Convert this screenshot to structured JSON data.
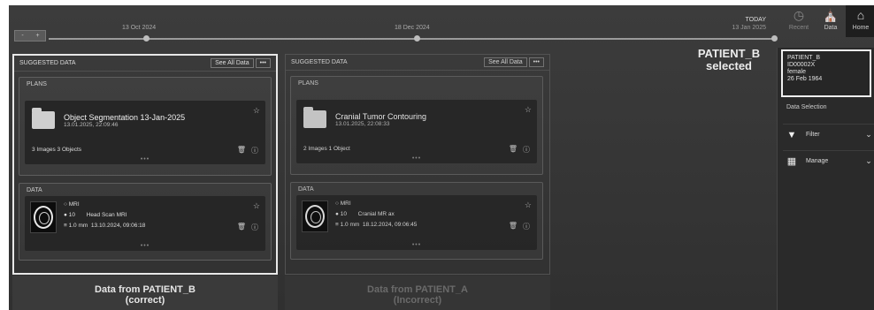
{
  "timeline": {
    "zoom_out": "-",
    "zoom_in": "+",
    "dates": [
      "13 Oct 2024",
      "18 Dec 2024"
    ],
    "today_label": "TODAY",
    "today_date": "13 Jan 2025"
  },
  "topbar": {
    "recent_label": "Recent",
    "data_label": "Data",
    "home_label": "Home"
  },
  "selection": {
    "label": "PATIENT_B\nselected"
  },
  "patient": {
    "name": "PATIENT_B",
    "id": "ID00002X",
    "sex": "female",
    "dob": "26 Feb 1964"
  },
  "sidebar": {
    "section_label": "Data Selection",
    "filter_label": "Filter",
    "manage_label": "Manage"
  },
  "columns": [
    {
      "header": "SUGGESTED DATA",
      "see_all": "See All Data",
      "more": "•••",
      "plans_title": "PLANS",
      "plan_name": "Object Segmentation 13-Jan-2025",
      "plan_date": "13.01.2025, 22:09:46",
      "plan_counts": "3 Images  3 Objects",
      "data_title": "DATA",
      "modality": "MRI",
      "num": "10",
      "series_name": "Head Scan MRI",
      "slice": "1.0 mm",
      "series_date": "13.10.2024, 09:06:18",
      "footer": "Data from PATIENT_B\n(correct)"
    },
    {
      "header": "SUGGESTED DATA",
      "see_all": "See All Data",
      "more": "•••",
      "plans_title": "PLANS",
      "plan_name": "Cranial Tumor Contouring",
      "plan_date": "13.01.2025, 22:08:33",
      "plan_counts": "2 Images  1 Object",
      "data_title": "DATA",
      "modality": "MRI",
      "num": "10",
      "series_name": "Cranial MR ax",
      "slice": "1.0 mm",
      "series_date": "18.12.2024, 09:06:45",
      "footer": "Data from PATIENT_A\n(Incorrect)"
    }
  ],
  "icons": {
    "folder": "folder-icon",
    "star": "star-icon",
    "trash": "trash-icon",
    "info": "info-icon",
    "filter": "filter-icon",
    "manage": "manage-icon",
    "home": "home-icon",
    "data": "data-icon"
  }
}
